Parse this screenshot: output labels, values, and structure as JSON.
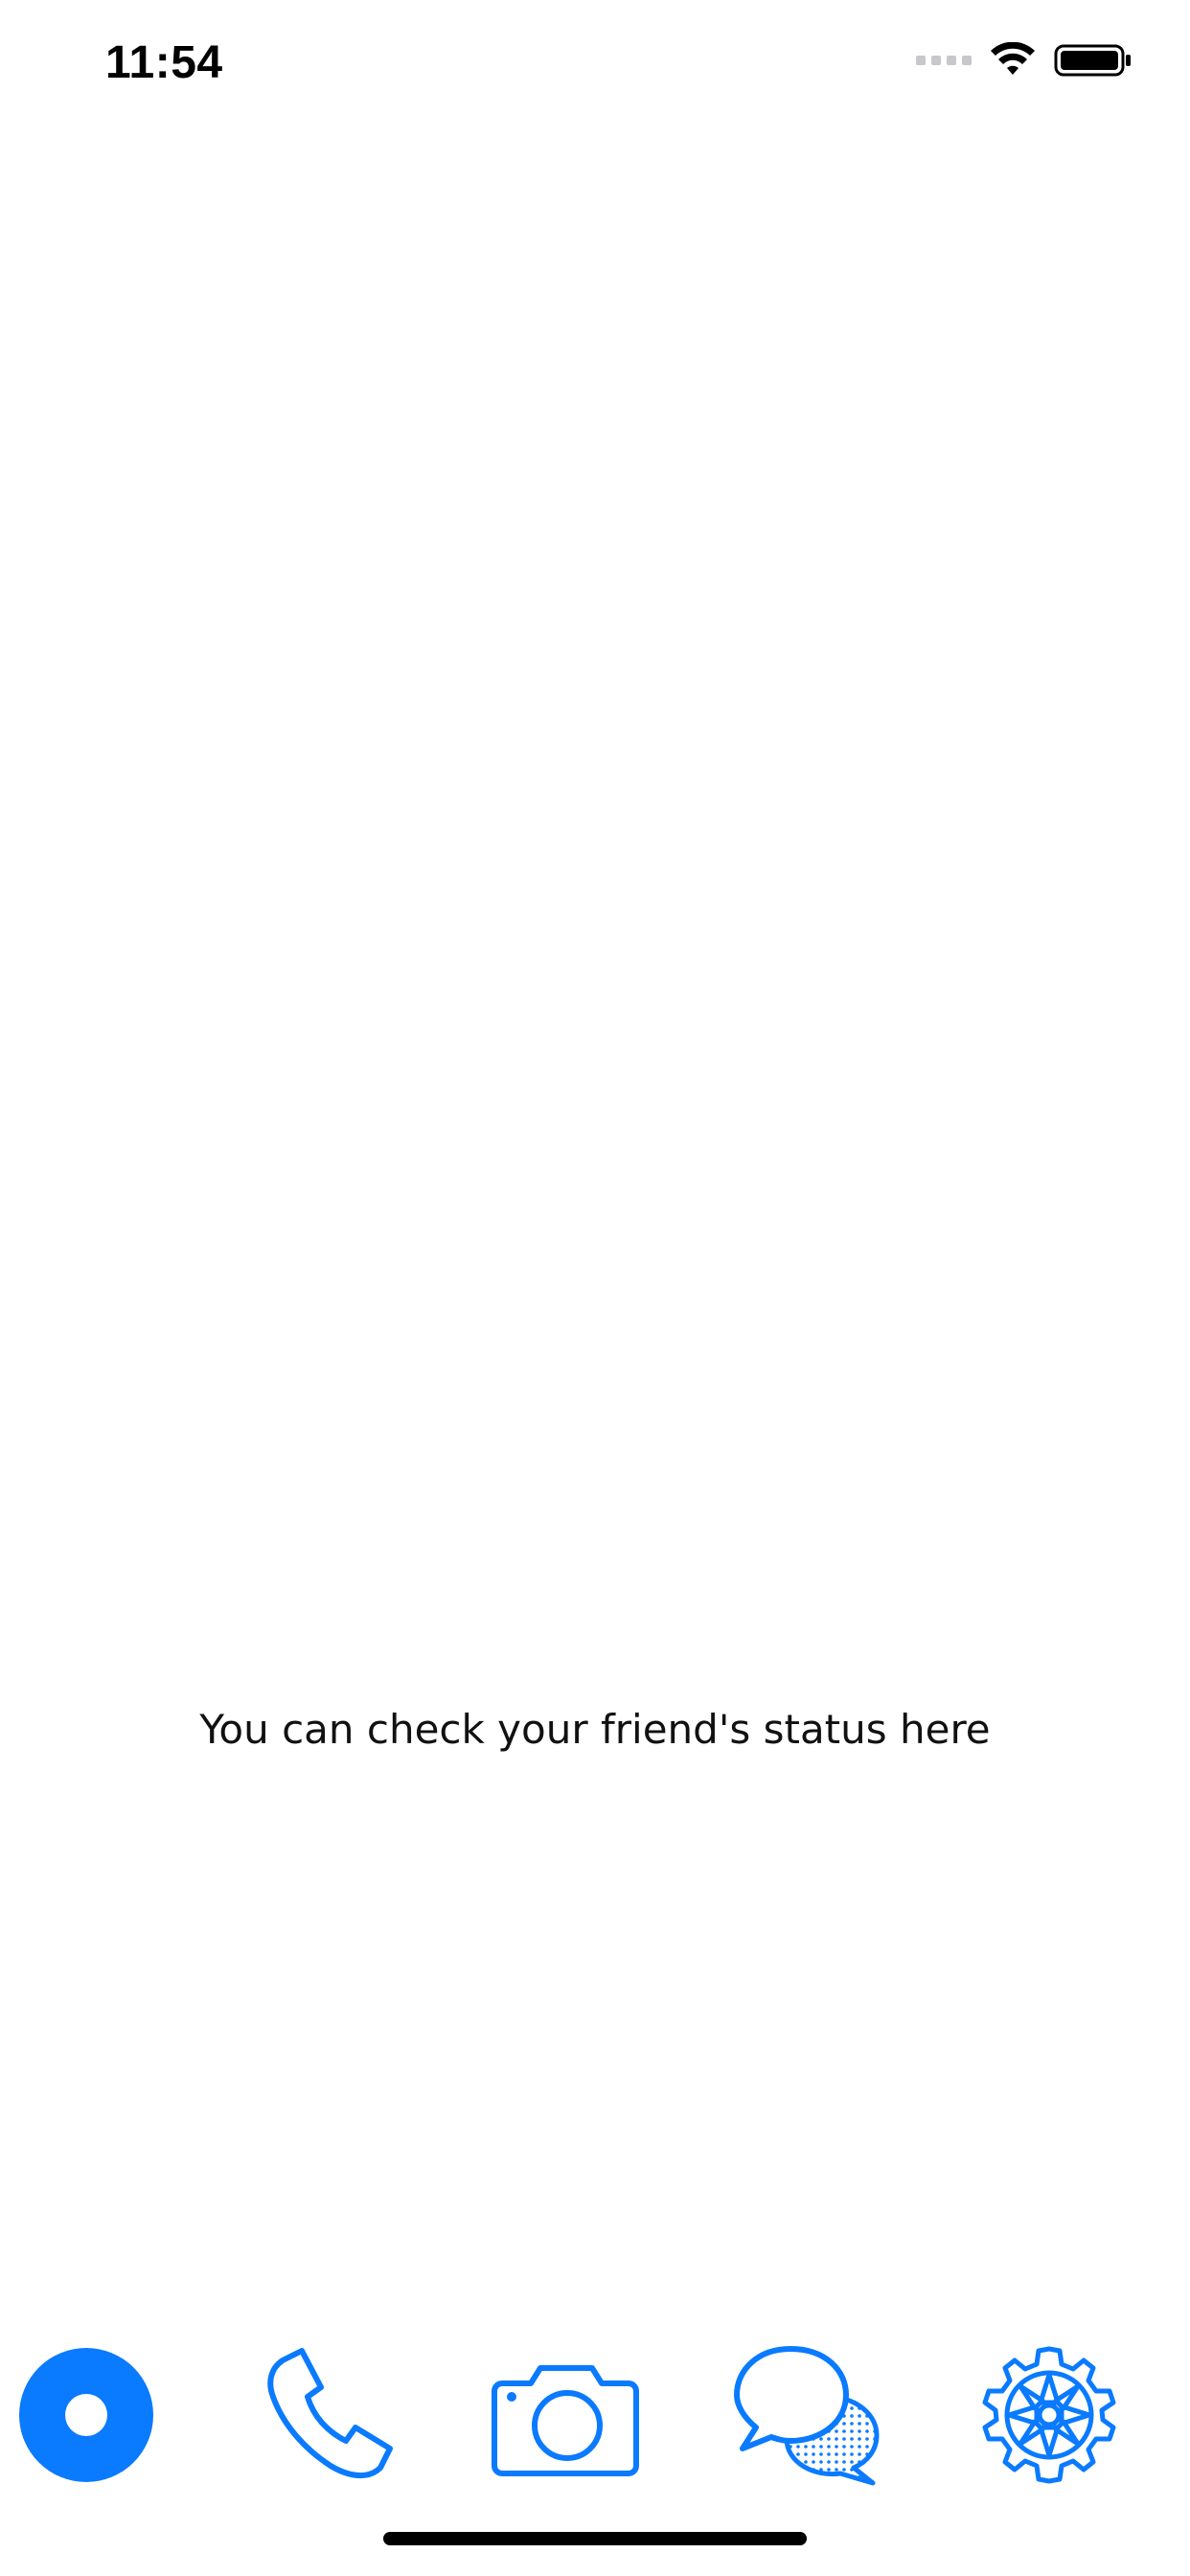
{
  "status_bar": {
    "time": "11:54"
  },
  "main": {
    "empty_message": "You can check your friend's status here"
  },
  "tab_bar": {
    "tabs": [
      {
        "name": "status",
        "icon": "status-ring-icon",
        "active": true
      },
      {
        "name": "calls",
        "icon": "phone-icon",
        "active": false
      },
      {
        "name": "camera",
        "icon": "camera-icon",
        "active": false
      },
      {
        "name": "chats",
        "icon": "chat-bubbles-icon",
        "active": false
      },
      {
        "name": "settings",
        "icon": "gear-icon",
        "active": false
      }
    ]
  },
  "colors": {
    "accent": "#0A7AFF",
    "inactive_signal": "#C7C7CC",
    "text": "#111111"
  }
}
